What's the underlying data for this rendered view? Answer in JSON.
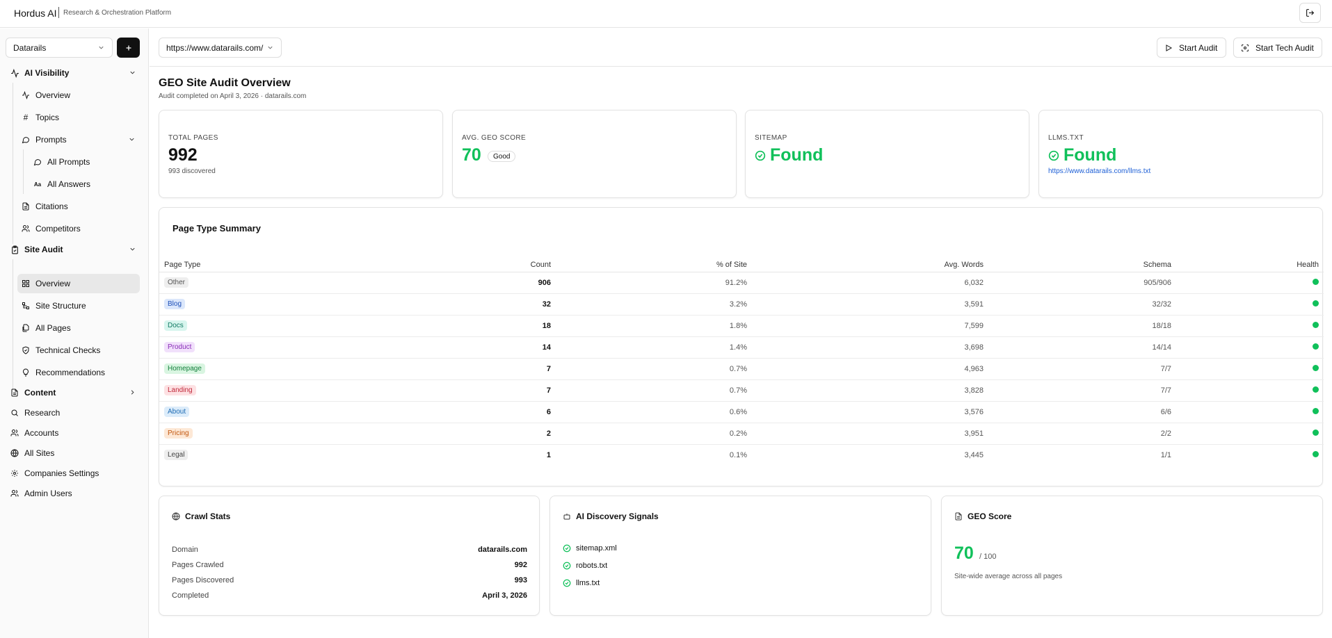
{
  "app": {
    "brand": "Hordus AI",
    "subtitle": "Research & Orchestration Platform"
  },
  "sidebar": {
    "org": "Datarails",
    "ai_visibility": "AI Visibility",
    "overview1": "Overview",
    "topics": "Topics",
    "prompts": "Prompts",
    "all_prompts": "All Prompts",
    "all_answers": "All Answers",
    "citations": "Citations",
    "competitors": "Competitors",
    "site_audit": "Site Audit",
    "overview2": "Overview",
    "site_structure": "Site Structure",
    "all_pages": "All Pages",
    "technical_checks": "Technical Checks",
    "recommendations": "Recommendations",
    "content": "Content",
    "research": "Research",
    "accounts": "Accounts",
    "all_sites": "All Sites",
    "companies_settings": "Companies Settings",
    "admin_users": "Admin Users"
  },
  "toolbar": {
    "url": "https://www.datarails.com/",
    "start_audit": "Start Audit",
    "start_tech_audit": "Start Tech Audit"
  },
  "header": {
    "title": "GEO Site Audit Overview",
    "subtitle": "Audit completed on April 3, 2026  · datarails.com"
  },
  "kpis": {
    "total_pages_label": "TOTAL PAGES",
    "total_pages_value": "992",
    "total_pages_sub": "993 discovered",
    "geo_label": "AVG. GEO SCORE",
    "geo_value": "70",
    "geo_badge": "Good",
    "sitemap_label": "SITEMAP",
    "sitemap_value": "Found",
    "llms_label": "LLMS.TXT",
    "llms_value": "Found",
    "llms_link": "https://www.datarails.com/llms.txt"
  },
  "summary": {
    "title": "Page Type Summary",
    "headers": [
      "Page Type",
      "Count",
      "% of Site",
      "Avg. Words",
      "Schema",
      "Health"
    ],
    "rows": [
      {
        "type": "Other",
        "count": "906",
        "pct": "91.2%",
        "words": "6,032",
        "schema": "905/906",
        "bg": "#eeeeee",
        "fg": "#555555",
        "health": "good"
      },
      {
        "type": "Blog",
        "count": "32",
        "pct": "3.2%",
        "words": "3,591",
        "schema": "32/32",
        "bg": "#dbe7fb",
        "fg": "#1d4fb8",
        "health": "good"
      },
      {
        "type": "Docs",
        "count": "18",
        "pct": "1.8%",
        "words": "7,599",
        "schema": "18/18",
        "bg": "#d7f5ee",
        "fg": "#117a63",
        "health": "good"
      },
      {
        "type": "Product",
        "count": "14",
        "pct": "1.4%",
        "words": "3,698",
        "schema": "14/14",
        "bg": "#f1e0fb",
        "fg": "#8a2db8",
        "health": "good"
      },
      {
        "type": "Homepage",
        "count": "7",
        "pct": "0.7%",
        "words": "4,963",
        "schema": "7/7",
        "bg": "#d9f5e1",
        "fg": "#15803d",
        "health": "good"
      },
      {
        "type": "Landing",
        "count": "7",
        "pct": "0.7%",
        "words": "3,828",
        "schema": "7/7",
        "bg": "#fde1e3",
        "fg": "#c0283a",
        "health": "good"
      },
      {
        "type": "About",
        "count": "6",
        "pct": "0.6%",
        "words": "3,576",
        "schema": "6/6",
        "bg": "#dcecfa",
        "fg": "#1c6ab3",
        "health": "good"
      },
      {
        "type": "Pricing",
        "count": "2",
        "pct": "0.2%",
        "words": "3,951",
        "schema": "2/2",
        "bg": "#fde8d6",
        "fg": "#c2570f",
        "health": "good"
      },
      {
        "type": "Legal",
        "count": "1",
        "pct": "0.1%",
        "words": "3,445",
        "schema": "1/1",
        "bg": "#eeeeee",
        "fg": "#444444",
        "health": "good"
      }
    ]
  },
  "crawl": {
    "title": "Crawl Stats",
    "rows": [
      {
        "k": "Domain",
        "v": "datarails.com"
      },
      {
        "k": "Pages Crawled",
        "v": "992"
      },
      {
        "k": "Pages Discovered",
        "v": "993"
      },
      {
        "k": "Completed",
        "v": "April 3, 2026"
      }
    ]
  },
  "signals": {
    "title": "AI Discovery Signals",
    "items": [
      "sitemap.xml",
      "robots.txt",
      "llms.txt"
    ]
  },
  "geo": {
    "title": "GEO Score",
    "value": "70",
    "max": "/ 100",
    "desc": "Site-wide average across all pages"
  },
  "colors": {
    "accent_green": "#10c05a",
    "link_blue": "#1d5fd6"
  }
}
